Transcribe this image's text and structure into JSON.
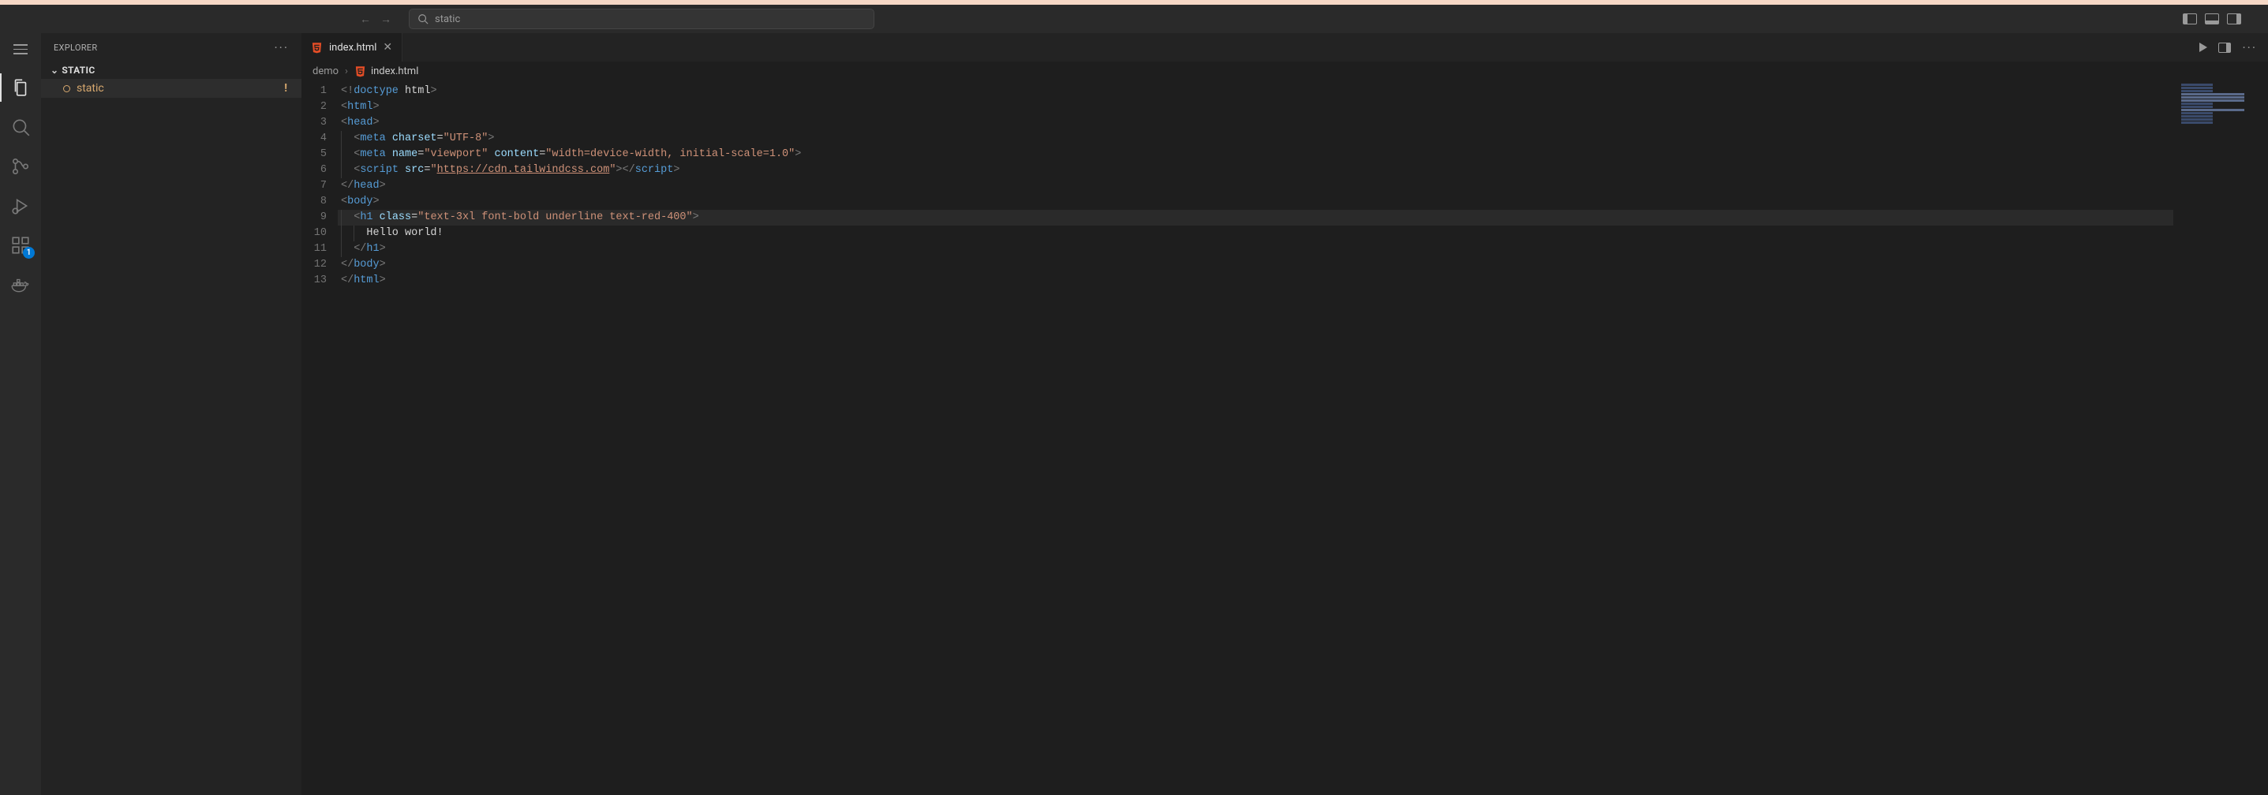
{
  "command_center": {
    "text": "static"
  },
  "sidebar": {
    "title": "EXPLORER",
    "folder": "STATIC",
    "items": [
      {
        "name": "static",
        "dirty": true,
        "warn": "!"
      }
    ]
  },
  "activitybar": {
    "extensions_badge": "1"
  },
  "tabs": [
    {
      "label": "index.html"
    }
  ],
  "breadcrumbs": {
    "folder": "demo",
    "file": "index.html"
  },
  "gutter": [
    "1",
    "2",
    "3",
    "4",
    "5",
    "6",
    "7",
    "8",
    "9",
    "10",
    "11",
    "12",
    "13"
  ],
  "code": {
    "l1": {
      "a": "<!",
      "b": "doctype",
      "c": " ",
      "d": "html",
      "e": ">"
    },
    "l2": {
      "a": "<",
      "b": "html",
      "c": ">"
    },
    "l3": {
      "a": "<",
      "b": "head",
      "c": ">"
    },
    "l4": {
      "a": "<",
      "b": "meta",
      "sp": " ",
      "c": "charset",
      "eq": "=",
      "v": "\"UTF-8\"",
      "e": ">"
    },
    "l5": {
      "a": "<",
      "b": "meta",
      "sp": " ",
      "n": "name",
      "eq": "=",
      "nv": "\"viewport\"",
      "sp2": " ",
      "c": "content",
      "eq2": "=",
      "cv": "\"width=device-width, initial-scale=1.0\"",
      "e": ">"
    },
    "l6": {
      "a": "<",
      "b": "script",
      "sp": " ",
      "s": "src",
      "eq": "=",
      "q1": "\"",
      "url": "https://cdn.tailwindcss.com",
      "q2": "\"",
      "c": ">",
      "ca": "</",
      "cb": "script",
      "ce": ">"
    },
    "l7": {
      "a": "</",
      "b": "head",
      "c": ">"
    },
    "l8": {
      "a": "<",
      "b": "body",
      "c": ">"
    },
    "l9": {
      "a": "<",
      "b": "h1",
      "sp": " ",
      "c": "class",
      "eq": "=",
      "v": "\"text-3xl font-bold underline text-red-400\"",
      "e": ">"
    },
    "l10": {
      "t": "Hello world!"
    },
    "l11": {
      "a": "</",
      "b": "h1",
      "c": ">"
    },
    "l12": {
      "a": "</",
      "b": "body",
      "c": ">"
    },
    "l13": {
      "a": "</",
      "b": "html",
      "c": ">"
    }
  }
}
